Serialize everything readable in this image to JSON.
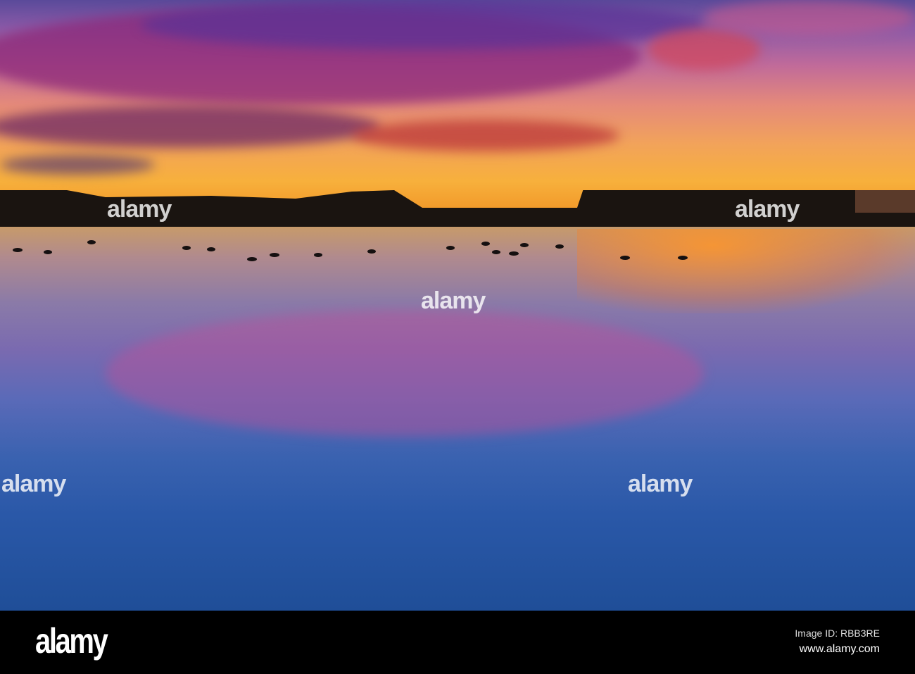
{
  "photo": {
    "subject": "Sunset over lake with geese and boathouse",
    "watermark": "alamy"
  },
  "footer": {
    "logo": "alamy",
    "image_id": "Image ID: RBB3RE",
    "website": "www.alamy.com"
  }
}
